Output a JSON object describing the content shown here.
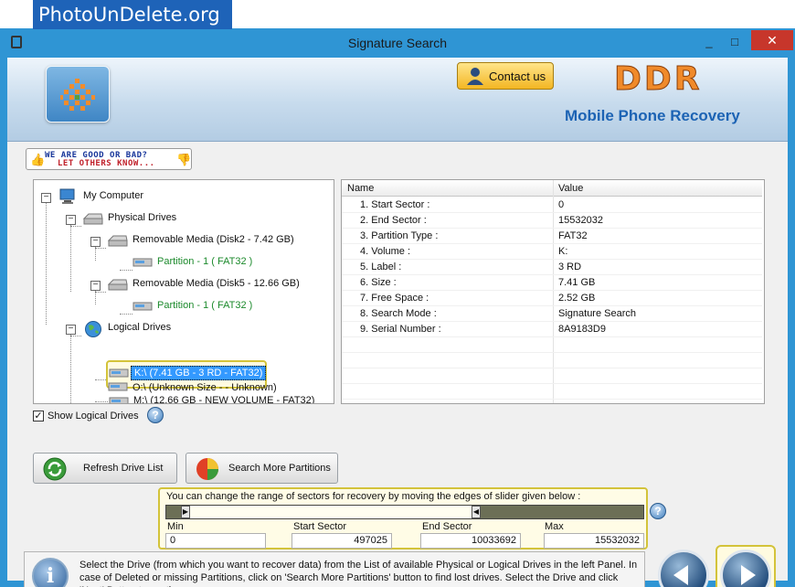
{
  "watermark": "PhotoUnDelete.org",
  "window": {
    "title": "Signature Search",
    "min_glyph": "_",
    "max_glyph": "□",
    "close_glyph": "✕"
  },
  "header": {
    "contact_label": "Contact us",
    "brand": "DDR",
    "subtitle": "Mobile Phone Recovery"
  },
  "badge": {
    "line1": "WE ARE GOOD OR BAD?",
    "line2": "LET OTHERS KNOW..."
  },
  "tree": {
    "root": "My Computer",
    "physical": "Physical Drives",
    "disk2": "Removable Media (Disk2 - 7.42 GB)",
    "disk2_part": "Partition - 1 ( FAT32 )",
    "disk5": "Removable Media (Disk5 - 12.66 GB)",
    "disk5_part": "Partition - 1 ( FAT32 )",
    "logical": "Logical Drives",
    "drive_k": "K:\\ (7.41 GB - 3 RD - FAT32)",
    "drive_m": "M:\\ (12.66 GB - NEW VOLUME - FAT32)",
    "drive_o": "O:\\ (Unknown Size  -  - Unknown)"
  },
  "details": {
    "col_name": "Name",
    "col_value": "Value",
    "rows": [
      {
        "k": "1. Start Sector :",
        "v": "0"
      },
      {
        "k": "2. End Sector :",
        "v": "15532032"
      },
      {
        "k": "3. Partition Type :",
        "v": "FAT32"
      },
      {
        "k": "4. Volume :",
        "v": "K:"
      },
      {
        "k": "5. Label :",
        "v": "3 RD"
      },
      {
        "k": "6. Size :",
        "v": "7.41 GB"
      },
      {
        "k": "7. Free Space :",
        "v": "2.52 GB"
      },
      {
        "k": "8. Search Mode :",
        "v": "Signature Search"
      },
      {
        "k": "9. Serial Number :",
        "v": "8A9183D9"
      }
    ]
  },
  "options": {
    "show_logical": "Show Logical Drives",
    "show_logical_checked": true
  },
  "buttons": {
    "refresh": "Refresh Drive List",
    "search_more": "Search More Partitions"
  },
  "range": {
    "title": "You can change the range of sectors for recovery by moving the edges of slider given below :",
    "min_label": "Min",
    "min_value": "0",
    "start_label": "Start Sector",
    "start_value": "497025",
    "end_label": "End Sector",
    "end_value": "10033692",
    "max_label": "Max",
    "max_value": "15532032",
    "slider": {
      "min": 0,
      "max": 15532032,
      "start": 497025,
      "end": 10033692
    }
  },
  "status": {
    "text": "Select the Drive (from which you want to recover data) from the List of available Physical or Logical Drives in the left Panel. In case of Deleted or missing Partitions, click on 'Search More Partitions' button to find lost drives. Select the Drive and click 'Next' Button to continue..."
  },
  "colors": {
    "accent": "#2f95d4",
    "highlight": "#d3c33a",
    "brand": "#f08a2a",
    "subtitle": "#1c63b4",
    "close": "#c7362b"
  }
}
